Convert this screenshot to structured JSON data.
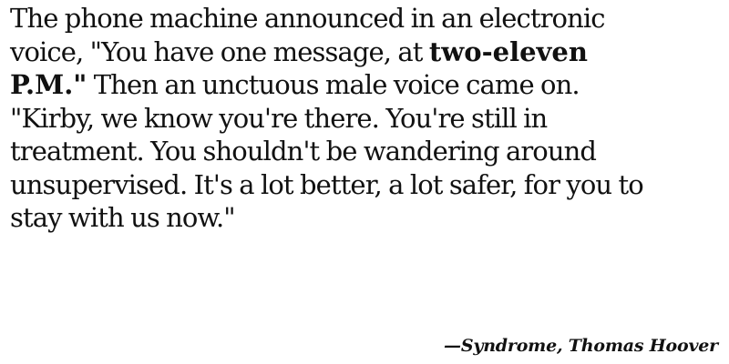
{
  "quote": {
    "line1": "The phone machine announced in an electronic",
    "line2_plain": "voice, \"You have one message, at ",
    "line2_bold": "two-eleven",
    "line3_bold": "P.M.\"",
    "line3_plain": " Then an unctuous male voice came on.",
    "line4": "\"Kirby, we know you're there. You're still in",
    "line5": "treatment. You shouldn't be wandering around",
    "line6": "unsupervised. It's a lot better, a lot safer, for you to",
    "line7": "stay with us now.\""
  },
  "attribution": "—Syndrome, Thomas Hoover"
}
